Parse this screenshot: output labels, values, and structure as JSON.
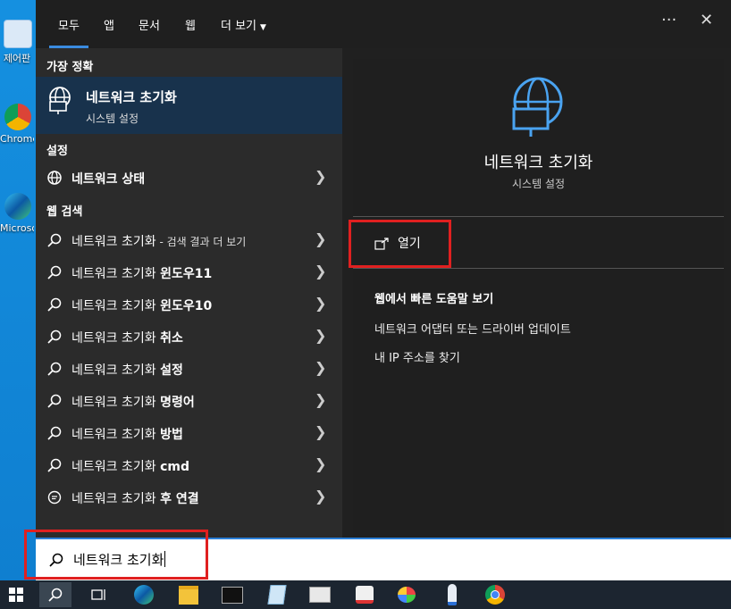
{
  "desktop": {
    "icons": [
      {
        "name": "control-panel",
        "label": "제어판"
      },
      {
        "name": "chrome",
        "label": "Chrome"
      },
      {
        "name": "edge",
        "label": "Microsoft Edge"
      }
    ]
  },
  "tabs": [
    {
      "label": "모두",
      "active": true
    },
    {
      "label": "앱"
    },
    {
      "label": "문서"
    },
    {
      "label": "웹"
    },
    {
      "label": "더 보기"
    }
  ],
  "window_controls": {
    "more": "···",
    "close": "✕"
  },
  "left": {
    "best_match_header": "가장 정확",
    "best_match": {
      "title": "네트워크 초기화",
      "subtitle": "시스템 설정"
    },
    "settings_header": "설정",
    "settings_item": "네트워크 상태",
    "web_header": "웹 검색",
    "web_items": [
      {
        "prefix": "네트워크 초기화",
        "suffix": " - 검색 결과 더 보기",
        "bold": ""
      },
      {
        "prefix": "네트워크 초기화 ",
        "suffix": "",
        "bold": "윈도우11"
      },
      {
        "prefix": "네트워크 초기화 ",
        "suffix": "",
        "bold": "윈도우10"
      },
      {
        "prefix": "네트워크 초기화 ",
        "suffix": "",
        "bold": "취소"
      },
      {
        "prefix": "네트워크 초기화 ",
        "suffix": "",
        "bold": "설정"
      },
      {
        "prefix": "네트워크 초기화 ",
        "suffix": "",
        "bold": "명령어"
      },
      {
        "prefix": "네트워크 초기화 ",
        "suffix": "",
        "bold": "방법"
      },
      {
        "prefix": "네트워크 초기화 ",
        "suffix": "",
        "bold": "cmd"
      },
      {
        "prefix": "네트워크 초기화 ",
        "suffix": "",
        "bold": "후 연결"
      }
    ]
  },
  "right": {
    "title": "네트워크 초기화",
    "subtitle": "시스템 설정",
    "open_label": "열기",
    "web_help_title": "웹에서 빠른 도움말 보기",
    "web_links": [
      "네트워크 어댑터 또는 드라이버 업데이트",
      "내 IP 주소를 찾기"
    ]
  },
  "search": {
    "value": "네트워크 초기화"
  },
  "colors": {
    "accent": "#3a8be0",
    "highlight_box": "#e02020",
    "best_match_bg": "#18324c"
  }
}
